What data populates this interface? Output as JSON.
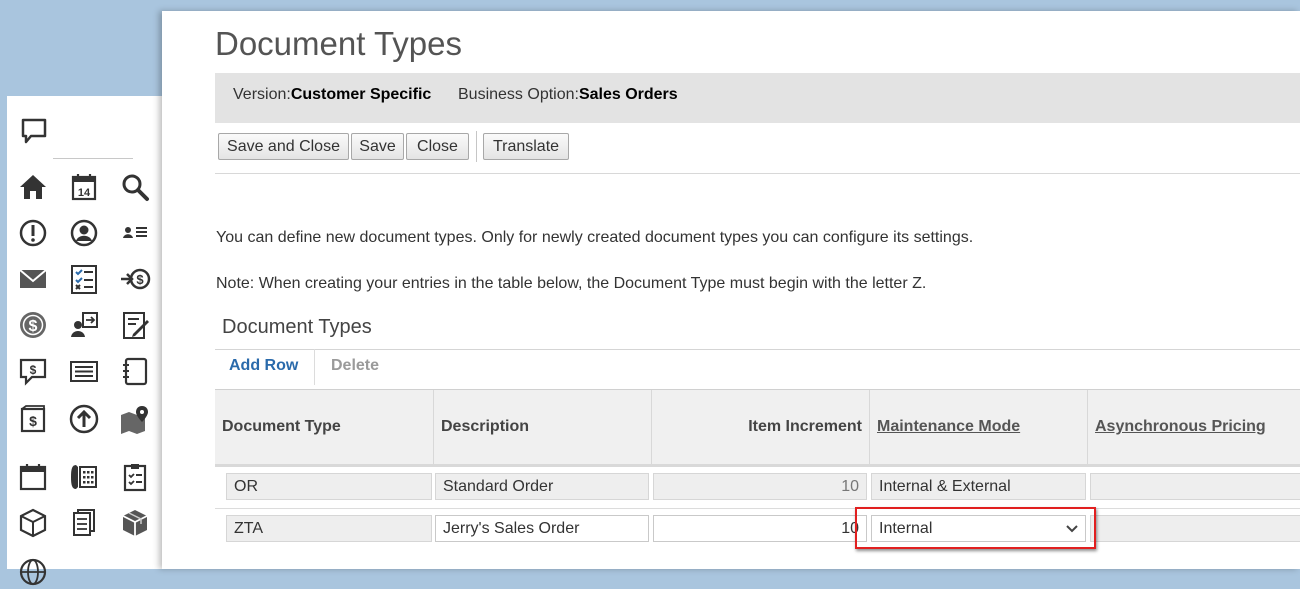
{
  "page": {
    "title": "Document Types",
    "version_label": "Version:",
    "version_value": "Customer Specific",
    "business_option_label": "Business Option:",
    "business_option_value": "Sales Orders"
  },
  "toolbar": {
    "save_and_close": "Save and Close",
    "save": "Save",
    "close": "Close",
    "translate": "Translate"
  },
  "instructions": {
    "line1": "You can define new document types. Only for newly created document types you can configure its settings.",
    "line2": "Note: When creating your entries in the table below, the Document Type must begin with the letter Z."
  },
  "section": {
    "title": "Document Types",
    "add_row": "Add Row",
    "delete": "Delete"
  },
  "table": {
    "columns": [
      "Document Type",
      "Description",
      "Item Increment",
      "Maintenance Mode",
      "Asynchronous Pricing"
    ],
    "rows": [
      {
        "document_type": "OR",
        "description": "Standard Order",
        "item_increment": "10",
        "maintenance_mode": "Internal & External",
        "asynchronous_pricing": ""
      },
      {
        "document_type": "ZTA",
        "description": "Jerry's Sales Order",
        "item_increment": "10",
        "maintenance_mode": "Internal",
        "asynchronous_pricing": ""
      }
    ]
  },
  "left_rail": {
    "icons": [
      "chat-bubble-icon",
      "home-icon",
      "calendar-icon",
      "search-icon",
      "alert-icon",
      "user-circle-icon",
      "contacts-list-icon",
      "mail-icon",
      "checklist-icon",
      "incoming-payment-icon",
      "money-icon",
      "user-transfer-icon",
      "edit-form-icon",
      "feedback-icon",
      "list-icon",
      "notebook-icon",
      "dollar-document-icon",
      "upload-icon",
      "map-pin-icon",
      "appointment-icon",
      "phone-calculator-icon",
      "clipboard-icon",
      "product-icon",
      "documents-icon",
      "package-icon",
      "globe-icon"
    ]
  },
  "colors": {
    "link": "#2a6aab",
    "highlight": "#e12020",
    "info_bar": "#e3e3e3",
    "background": "#a9c5de"
  }
}
